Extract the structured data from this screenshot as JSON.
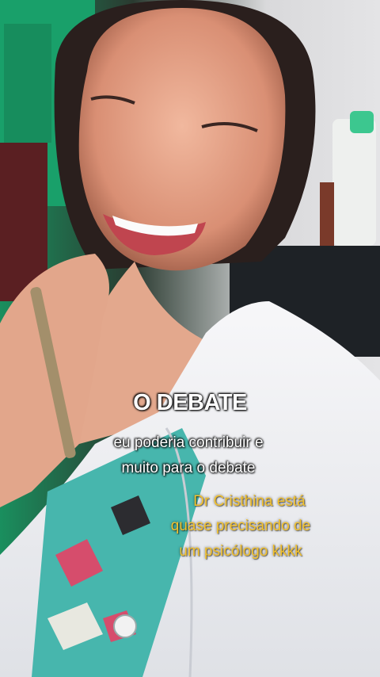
{
  "captions": {
    "title": "O DEBATE",
    "line1": "eu poderia contribuir e",
    "line2": "muito para o debate"
  },
  "comment": {
    "line1": "Dr Cristhina está",
    "line2": "quase precisando de",
    "line3": "um psicólogo kkkk"
  },
  "colors": {
    "title": "#ffffff",
    "comment": "#f2c12e",
    "wall_green": "#1a9f6a",
    "coat": "#f3f4f6"
  }
}
